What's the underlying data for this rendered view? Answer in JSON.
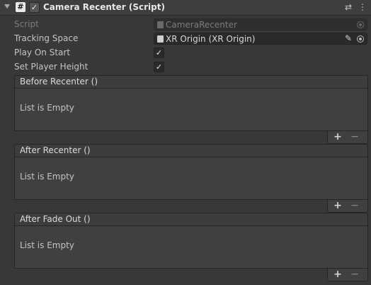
{
  "component": {
    "title": "Camera Recenter (Script)",
    "script_icon": "#",
    "enabled_check": "✓",
    "settings_icon": "⇄",
    "menu_icon": "⋮"
  },
  "properties": {
    "script": {
      "label": "Script",
      "value": "CameraRecenter"
    },
    "tracking_space": {
      "label": "Tracking Space",
      "value": "XR Origin (XR Origin)",
      "edit_icon": "✎"
    },
    "play_on_start": {
      "label": "Play On Start",
      "checked": true,
      "check": "✓"
    },
    "set_player_height": {
      "label": "Set Player Height",
      "checked": true,
      "check": "✓"
    }
  },
  "events": [
    {
      "header": "Before Recenter ()",
      "empty_text": "List is Empty",
      "add": "+",
      "remove": "−"
    },
    {
      "header": "After Recenter ()",
      "empty_text": "List is Empty",
      "add": "+",
      "remove": "−"
    },
    {
      "header": "After Fade Out ()",
      "empty_text": "List is Empty",
      "add": "+",
      "remove": "−"
    }
  ]
}
